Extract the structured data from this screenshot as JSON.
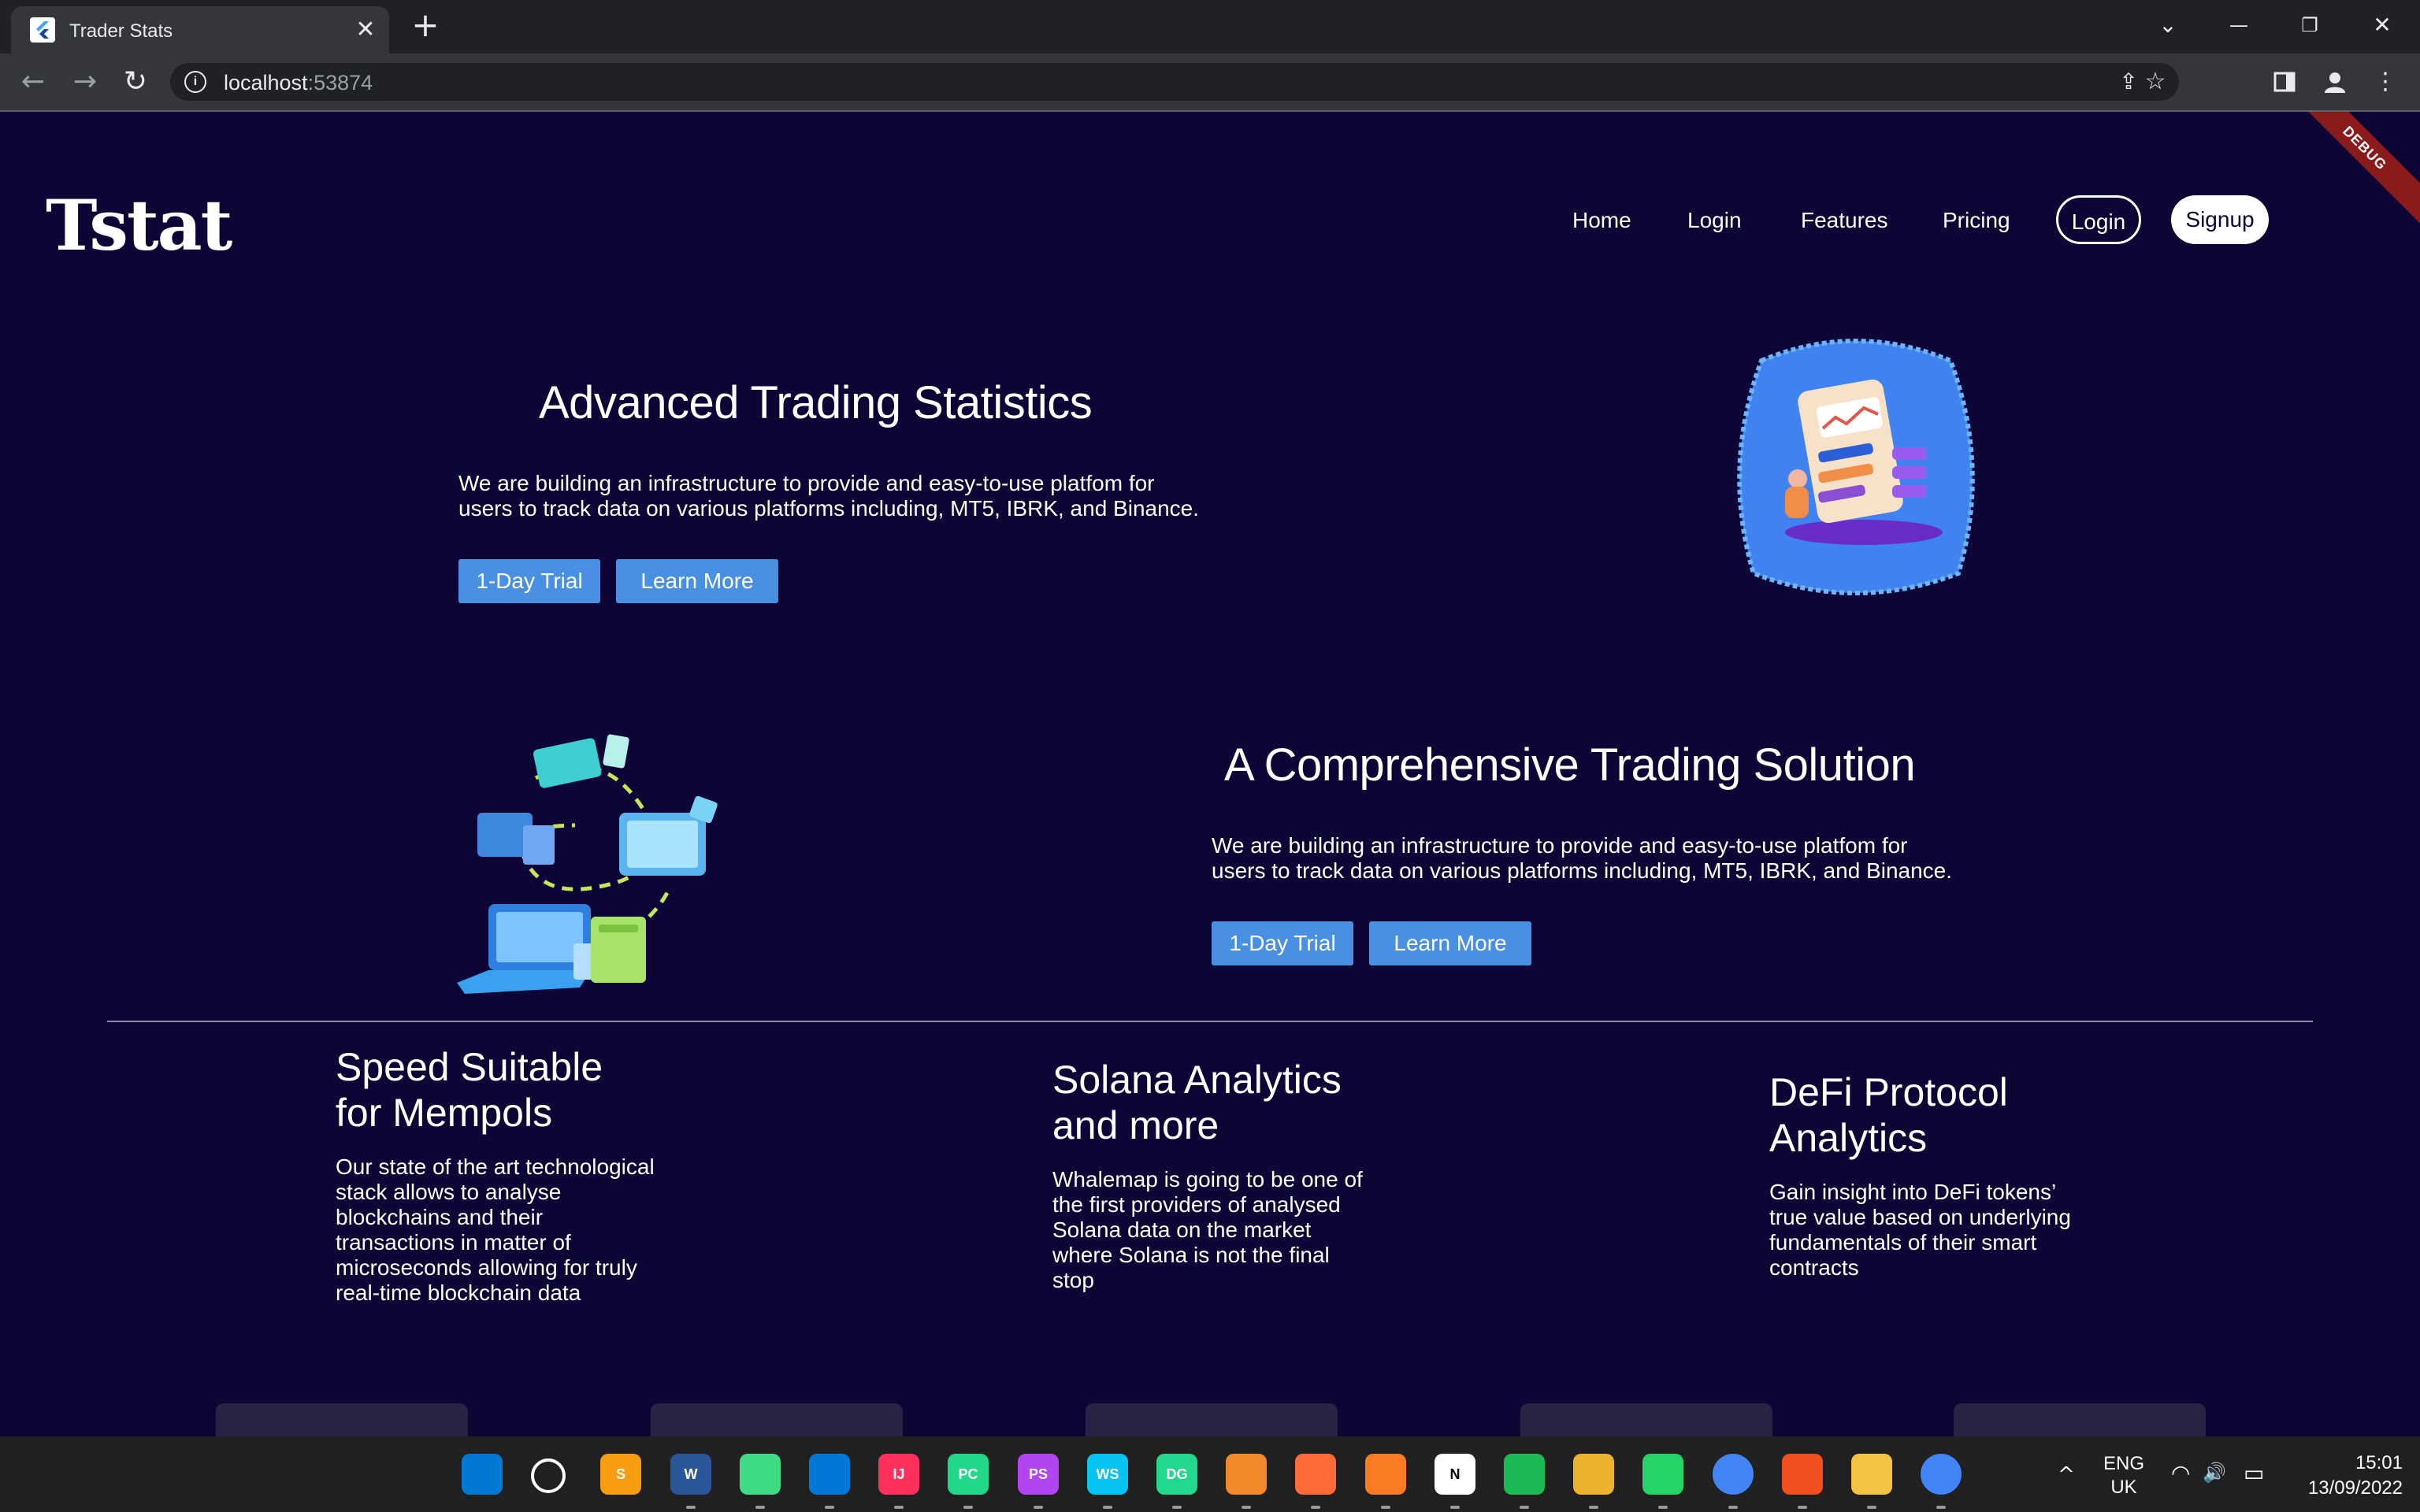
{
  "browser": {
    "tab_title": "Trader Stats",
    "close_glyph": "✕",
    "new_tab_glyph": "+",
    "url_host": "localhost",
    "url_port": ":53874",
    "window_controls": [
      "⌄",
      "—",
      "❐",
      "✕"
    ]
  },
  "app": {
    "debug_banner": "DEBUG",
    "logo": "Tstat",
    "nav": {
      "home": "Home",
      "login_link": "Login",
      "features": "Features",
      "pricing": "Pricing",
      "login_button": "Login",
      "signup_button": "Signup"
    },
    "hero1": {
      "title": "Advanced Trading Statistics",
      "text": "We are building an infrastructure to provide and easy-to-use platfom for users to track data on various platforms including, MT5, IBRK, and Binance.",
      "trial_button": "1-Day Trial",
      "learn_button": "Learn More"
    },
    "hero2": {
      "title": "A Comprehensive Trading Solution",
      "text": "We are building an infrastructure to provide and easy-to-use platfom for users to track data on various platforms including, MT5, IBRK, and Binance.",
      "trial_button": "1-Day Trial",
      "learn_button": "Learn More"
    },
    "features": [
      {
        "title_line1": "Speed Suitable",
        "title_line2": "for Mempols",
        "text": "Our state of the art technological stack allows to analyse blockchains and their transactions in matter of microseconds allowing for truly real-time blockchain data"
      },
      {
        "title_line1": "Solana Analytics",
        "title_line2": "and more",
        "text": "Whalemap is going to be one of the first providers of analysed Solana data on the market where Solana is not the final stop"
      },
      {
        "title_line1": "DeFi Protocol",
        "title_line2": "Analytics",
        "text": "Gain insight into DeFi tokens’ true value based on underlying fundamentals of their smart contracts"
      }
    ]
  },
  "taskbar": {
    "apps": [
      "windows-start",
      "search",
      "sublime-text",
      "word",
      "android-studio",
      "vscode",
      "intellij",
      "pycharm",
      "phpstorm",
      "webstorm",
      "datagrip",
      "git-bash",
      "postman",
      "xampp",
      "notion",
      "spotify",
      "slack",
      "whatsapp",
      "chrome-profile",
      "figma",
      "file-explorer",
      "chrome"
    ],
    "app_labels": [
      "",
      "",
      "S",
      "W",
      "",
      "",
      "IJ",
      "PC",
      "PS",
      "WS",
      "DG",
      "",
      "",
      "",
      "N",
      "",
      "",
      "",
      "",
      "",
      "",
      ""
    ],
    "app_colors": [
      "#0078d4",
      "#202020",
      "#f89d0f",
      "#2b579a",
      "#3ddc84",
      "#0078d7",
      "#fe315d",
      "#21d789",
      "#b345f1",
      "#07c3f2",
      "#22d88f",
      "#f28a2b",
      "#ff6c37",
      "#fb7a24",
      "#ffffff",
      "#1db954",
      "#ecb22e",
      "#25d366",
      "#4285f4",
      "#f24e1e",
      "#f5c342",
      "#4285f4"
    ],
    "language_top": "ENG",
    "language_bottom": "UK",
    "time": "15:01",
    "date": "13/09/2022",
    "tray_chevron": "^",
    "wifi_glyph": "◠",
    "volume_glyph": "🔊",
    "battery_glyph": "▭"
  }
}
